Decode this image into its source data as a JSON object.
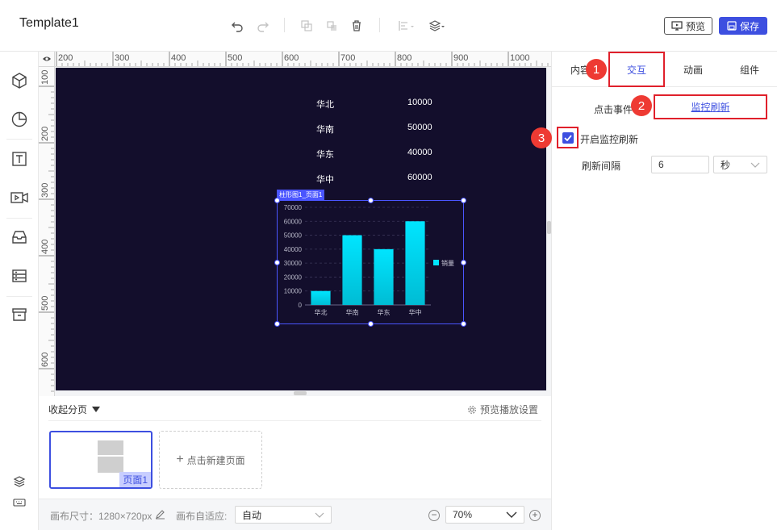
{
  "header": {
    "title": "Template1",
    "preview_label": "预览",
    "save_label": "保存"
  },
  "ruler": {
    "top_labels": [
      "200",
      "300",
      "400",
      "500",
      "600",
      "700",
      "800",
      "900",
      "1000"
    ],
    "left_labels": [
      "100",
      "200",
      "300",
      "400",
      "500",
      "600"
    ]
  },
  "canvas": {
    "table": [
      {
        "region": "华北",
        "value": "10000"
      },
      {
        "region": "华南",
        "value": "50000"
      },
      {
        "region": "华东",
        "value": "40000"
      },
      {
        "region": "华中",
        "value": "60000"
      }
    ],
    "chart_tag": "柱形图1_页面1"
  },
  "chart_data": {
    "type": "bar",
    "categories": [
      "华北",
      "华南",
      "华东",
      "华中"
    ],
    "series": [
      {
        "name": "销量",
        "values": [
          10000,
          50000,
          40000,
          60000
        ]
      }
    ],
    "y_ticks": [
      "70000",
      "60000",
      "50000",
      "40000",
      "30000",
      "20000",
      "10000",
      "0"
    ],
    "ylim": [
      0,
      70000
    ],
    "legend_position": "right",
    "bar_color_top": "#00e5ff",
    "bar_color_bottom": "#00bcd4"
  },
  "pages": {
    "collapse_label": "收起分页",
    "settings_label": "预览播放设置",
    "page1_label": "页面1",
    "new_page_label": "点击新建页面"
  },
  "status": {
    "canvas_size_label": "画布尺寸：1280×720px",
    "adapt_label": "画布自适应:",
    "adapt_value": "自动",
    "zoom_value": "70%"
  },
  "panel": {
    "tabs": [
      "内容",
      "交互",
      "动画",
      "组件"
    ],
    "active_tab": "交互",
    "click_event_label": "点击事件",
    "event_value": "监控刷新",
    "enable_label": "开启监控刷新",
    "interval_label": "刷新间隔",
    "interval_value": "6",
    "unit_value": "秒",
    "badges": [
      "1",
      "2",
      "3"
    ]
  },
  "colors": {
    "accent": "#3d4fe0",
    "canvas_bg": "#130e2c",
    "highlight_red": "#e0202b",
    "badge_red": "#ee3a33"
  }
}
